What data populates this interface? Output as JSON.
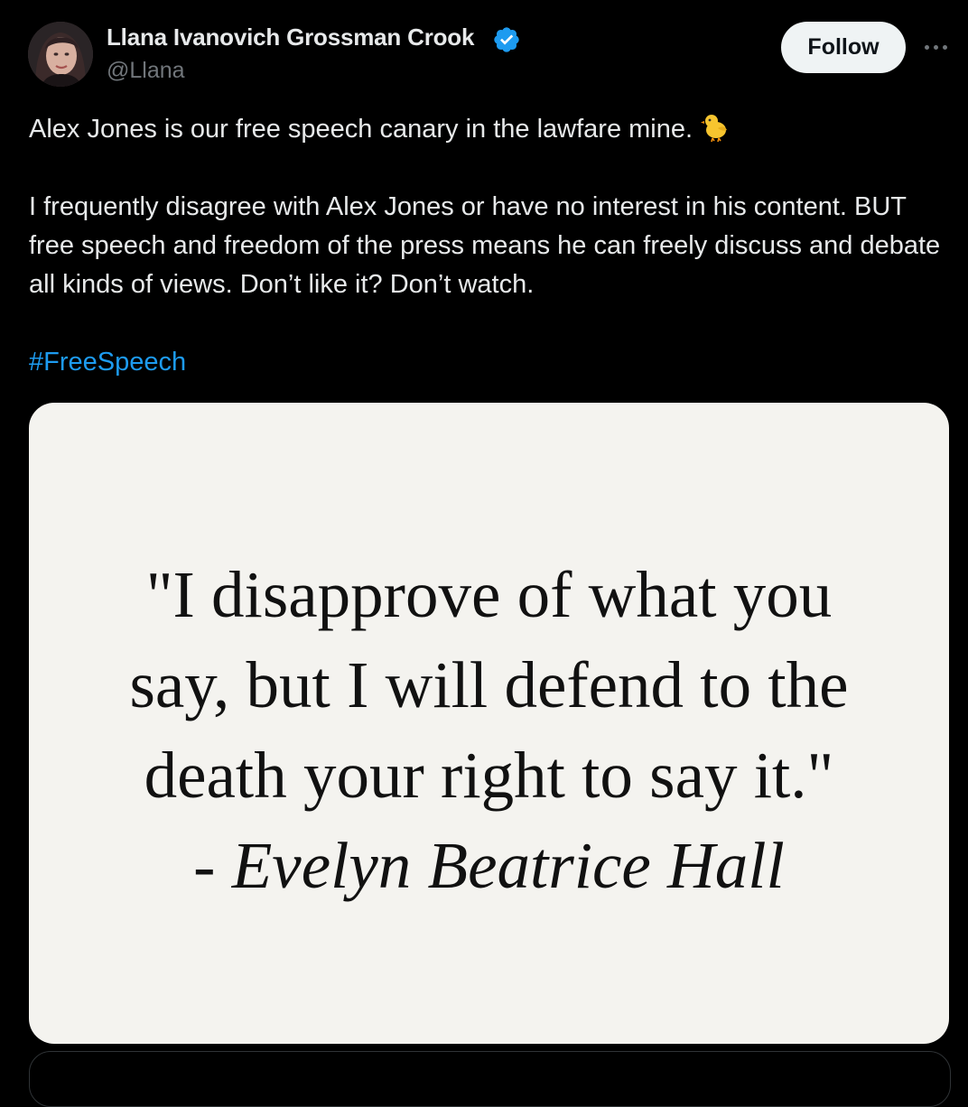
{
  "author": {
    "display_name": "Llana Ivanovich Grossman Crook",
    "handle": "@Llana",
    "verified_badge_icon": "verified-badge-icon",
    "avatar_icon": "avatar-photo"
  },
  "actions": {
    "follow_label": "Follow",
    "more_icon": "more-options-icon"
  },
  "tweet": {
    "line1": "Alex Jones is our free speech canary in the lawfare mine.",
    "line1_emoji": "chick-emoji-icon",
    "paragraph2": "I frequently disagree with Alex Jones or have no interest in his content. BUT free speech and freedom of the press means he can freely discuss and debate all kinds of views. Don’t like it? Don’t watch.",
    "hashtag": "#FreeSpeech"
  },
  "media": {
    "quote_lines": [
      "\"I disapprove of what you",
      "say, but I will defend to the",
      "death your right to say it.\""
    ],
    "attribution": "- Evelyn Beatrice Hall"
  },
  "colors": {
    "background": "#000000",
    "text_primary": "#e7e9ea",
    "text_secondary": "#71767b",
    "link": "#1d9bf0",
    "verified": "#1d9bf0",
    "follow_bg": "#eff3f4",
    "card_bg": "#f4f3ef"
  }
}
